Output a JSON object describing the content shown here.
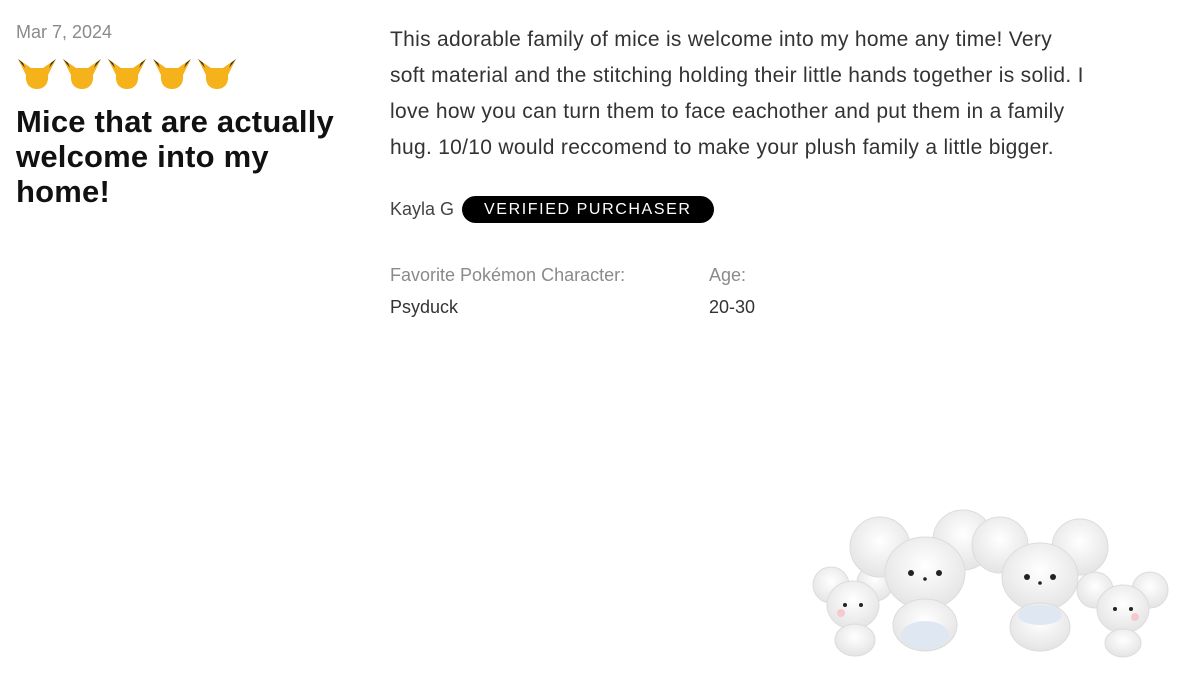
{
  "review": {
    "date": "Mar 7, 2024",
    "rating": 5,
    "rating_icon": "pikachu-head-icon",
    "rating_color": "#F5B21A",
    "title": "Mice that are actually welcome into my home!",
    "body": "This adorable family of mice is welcome into my home any time! Very soft material and the stitching holding their little hands together is solid. I love how you can turn them to face eachother and put them in a family hug. 10/10 would reccomend to make your plush family a little bigger.",
    "reviewer_name": "Kayla G",
    "verified_label": "VERIFIED PURCHASER",
    "attributes": [
      {
        "label": "Favorite Pokémon Character:",
        "value": "Psyduck"
      },
      {
        "label": "Age:",
        "value": "20-30"
      }
    ],
    "product_image": "mouse-plush-family-image"
  }
}
